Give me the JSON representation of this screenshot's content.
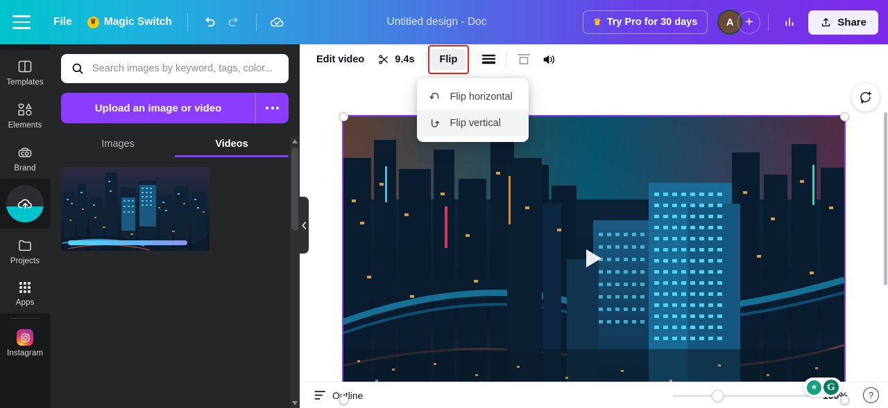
{
  "topbar": {
    "menu_icon": "hamburger-icon",
    "file_label": "File",
    "magic_switch_label": "Magic Switch",
    "magic_switch_badge_icon": "crown-icon",
    "undo_icon": "undo-icon",
    "redo_icon": "redo-icon",
    "cloud_saved_icon": "cloud-check-icon",
    "doc_title": "Untitled design - Doc",
    "try_pro_label": "Try Pro for 30 days",
    "try_pro_icon": "crown-icon",
    "avatar_initial": "A",
    "add_member_icon": "plus-icon",
    "insights_icon": "bar-chart-icon",
    "share_label": "Share",
    "share_icon": "upload-arrow-icon"
  },
  "rail": {
    "items": [
      {
        "label": "Templates",
        "icon": "templates-icon",
        "active": false
      },
      {
        "label": "Elements",
        "icon": "elements-icon",
        "active": false
      },
      {
        "label": "Brand",
        "icon": "brand-icon",
        "active": false
      },
      {
        "label": "Uploads",
        "icon": "cloud-upload-icon",
        "active": true
      },
      {
        "label": "Projects",
        "icon": "folder-icon",
        "active": false
      },
      {
        "label": "Apps",
        "icon": "apps-grid-icon",
        "active": false
      },
      {
        "label": "Instagram",
        "icon": "instagram-icon",
        "active": false
      }
    ]
  },
  "panel": {
    "search": {
      "icon": "search-icon",
      "value": "",
      "placeholder": "Search images by keyword, tags, color..."
    },
    "upload_button_label": "Upload an image or video",
    "upload_more_icon": "ellipsis-icon",
    "tabs": [
      {
        "label": "Images",
        "active": false
      },
      {
        "label": "Videos",
        "active": true
      }
    ],
    "media_items": [
      {
        "name": "night-cityscape-video",
        "type": "video"
      }
    ],
    "collapse_icon": "chevron-left-icon",
    "scroll_up_icon": "caret-up-icon",
    "scroll_down_icon": "caret-down-icon"
  },
  "toolbar": {
    "edit_video_label": "Edit video",
    "trim_icon": "scissors-icon",
    "duration_label": "9.4s",
    "flip_label": "Flip",
    "flip_highlighted": true,
    "position_icon": "position-layers-icon",
    "crop_icon": "crop-fit-icon",
    "volume_icon": "speaker-volume-icon"
  },
  "flip_menu": {
    "open": true,
    "items": [
      {
        "label": "Flip horizontal",
        "icon": "flip-horizontal-icon",
        "hover": false
      },
      {
        "label": "Flip vertical",
        "icon": "flip-vertical-icon",
        "hover": true
      }
    ]
  },
  "canvas": {
    "selected_media": "night-cityscape-video",
    "play_icon": "play-icon",
    "selection_color": "#8b3dff",
    "comment_icon": "add-comment-icon",
    "grammarly": {
      "bulb_icon": "grammarly-suggestion-icon",
      "logo_text": "G"
    }
  },
  "bottombar": {
    "outline_label": "Outline",
    "outline_icon": "outline-list-icon",
    "zoom_value": "100%",
    "zoom_percent": 100,
    "help_icon": "question-mark-icon"
  },
  "colors": {
    "brand_teal": "#00c4cc",
    "brand_purple": "#7d2ae8",
    "accent_purple": "#8b3dff",
    "annotation_red": "#f41f1f",
    "panel_bg": "#252628",
    "rail_bg": "#18191b"
  }
}
